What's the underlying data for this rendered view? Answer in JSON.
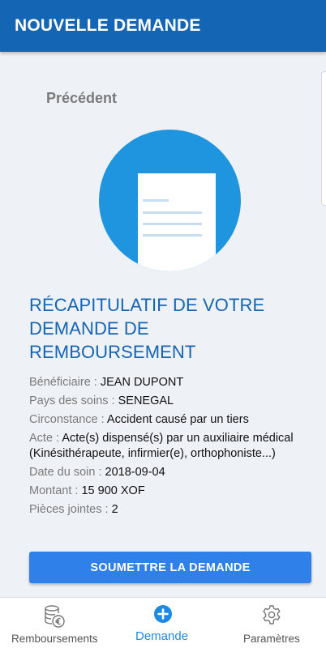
{
  "appbar": {
    "title": "NOUVELLE DEMANDE"
  },
  "nav": {
    "previous_label": "Précédent"
  },
  "hero": {
    "icon": "document-icon",
    "accent": "#1e95de"
  },
  "summary": {
    "title": "RÉCAPITULATIF DE VOTRE DEMANDE DE REMBOURSEMENT",
    "rows": [
      {
        "label": "Bénéficiaire : ",
        "value": "JEAN DUPONT"
      },
      {
        "label": "Pays des soins : ",
        "value": "SENEGAL"
      },
      {
        "label": "Circonstance : ",
        "value": "Accident causé par un tiers"
      },
      {
        "label": "Acte : ",
        "value": "Acte(s) dispensé(s) par un auxiliaire médical (Kinésithérapeute, infirmier(e), orthophoniste...)"
      },
      {
        "label": "Date du soin : ",
        "value": "2018-09-04"
      },
      {
        "label": "Montant : ",
        "value": "15 900 XOF"
      },
      {
        "label": "Pièces jointes : ",
        "value": "2"
      }
    ]
  },
  "actions": {
    "submit_label": "SOUMETTRE LA DEMANDE"
  },
  "bottom_nav": {
    "items": [
      {
        "label": "Remboursements",
        "icon": "coins-euro-icon",
        "active": false
      },
      {
        "label": "Demande",
        "icon": "add-circle-icon",
        "active": true
      },
      {
        "label": "Paramètres",
        "icon": "gear-icon",
        "active": false
      }
    ]
  },
  "colors": {
    "primary": "#1565b5",
    "button": "#2f80e8",
    "active_tab": "#1e88e5"
  }
}
